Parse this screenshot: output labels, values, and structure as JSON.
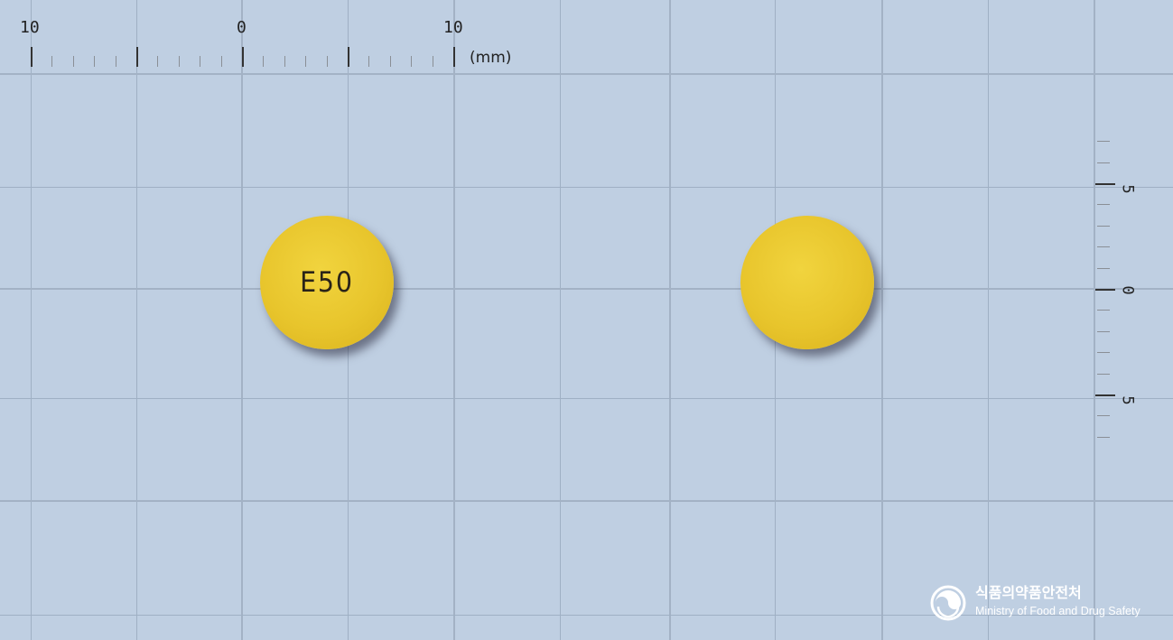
{
  "scale_top": {
    "labels": [
      "10",
      "0",
      "10"
    ],
    "unit": "(mm)"
  },
  "scale_right": {
    "labels": [
      "5",
      "0",
      "5"
    ]
  },
  "pills": [
    {
      "side": "front",
      "imprint": "E50",
      "color": "#e8c52c"
    },
    {
      "side": "back",
      "imprint": "",
      "color": "#e8c52c"
    }
  ],
  "logo": {
    "korean": "식품의약품안전처",
    "english": "Ministry of Food and Drug Safety",
    "icon": "mfds-emblem-icon"
  }
}
